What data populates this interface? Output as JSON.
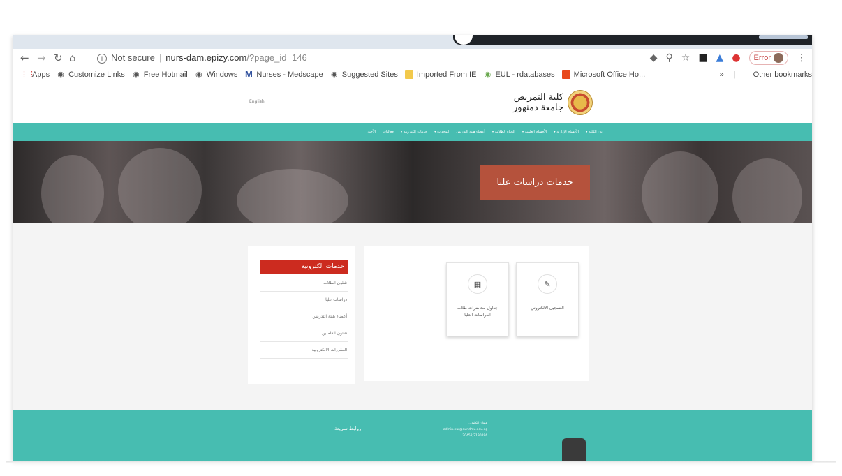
{
  "browser": {
    "security_label": "Not secure",
    "url_host": "nurs-dam.epizy.com",
    "url_path": "/?page_id=146",
    "error_label": "Error",
    "bookmarks": [
      {
        "label": "Apps",
        "icon": "apps-grid-icon"
      },
      {
        "label": "Customize Links",
        "icon": "globe-icon"
      },
      {
        "label": "Free Hotmail",
        "icon": "globe-icon"
      },
      {
        "label": "Windows",
        "icon": "globe-icon"
      },
      {
        "label": "Nurses - Medscape",
        "icon": "medscape-icon"
      },
      {
        "label": "Suggested Sites",
        "icon": "globe-icon"
      },
      {
        "label": "Imported From IE",
        "icon": "folder-icon"
      },
      {
        "label": "EUL - rdatabases",
        "icon": "globe-icon"
      },
      {
        "label": "Microsoft Office Ho...",
        "icon": "office-icon"
      }
    ],
    "overflow_label": "»",
    "other_bookmarks": "Other bookmarks"
  },
  "site": {
    "lang_link": "English",
    "logo_line1": "كلية التمريض",
    "logo_line2": "جامعة دمنهور",
    "menu": [
      "عن الكلية ▾",
      "الأقسام الإدارية ▾",
      "الأقسام العلمية ▾",
      "الحياة الطلابية ▾",
      "أعضاء هيئة التدريس",
      "الوحدات ▾",
      "خدمات إلكترونية ▾",
      "فعاليات",
      "الأخبار"
    ],
    "hero_title": "خدمات دراسات عليا",
    "sidebar": {
      "title": "خدمات الكترونية",
      "items": [
        "شئون الطلاب",
        "دراسات عليا",
        "أعضاء هيئة التدريس",
        "شئون العاملين",
        "المقررات الالكترونية"
      ]
    },
    "cards": [
      {
        "label": "التسجيل الالكتروني",
        "icon": "edit-icon"
      },
      {
        "label": "جداول محاضرات طلاب الدراسات العليا",
        "icon": "calendar-icon"
      }
    ],
    "footer": {
      "links_title": "روابط سريعة",
      "contact": [
        "عنوان الكلية...",
        "admin.nur@nur.dmu.edu.eg",
        "20452/2190296"
      ]
    }
  }
}
